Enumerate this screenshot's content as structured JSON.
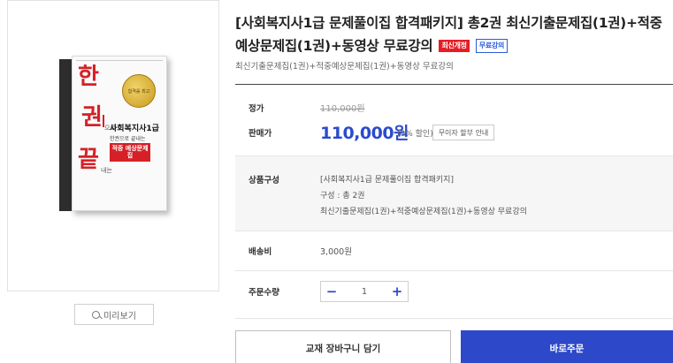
{
  "product": {
    "title_main": "[사회복지사1급 문제풀이집 합격패키지] 총2권 최신기출문제집(1권)+적중예상문제집(1권)+동영상 무료강의",
    "badges": [
      "최신개정",
      "무료강의"
    ],
    "subtitle": "최신기출문제집(1권)+적중예상문제집(1권)+동영상 무료강의"
  },
  "cover": {
    "big_chars": [
      "한",
      "권",
      "끝"
    ],
    "small_words": [
      "으로",
      "내는"
    ],
    "spine_text": "사회복지사1급",
    "badge_text": "합격률 최고",
    "subject": "사회복지사1급",
    "subject_sub": "한권으로 끝내는",
    "tag": "적중 예상문제집"
  },
  "preview": {
    "label": "미리보기",
    "icon": "search-icon"
  },
  "price": {
    "list_label": "정가",
    "list_value": "110,000원",
    "sale_label": "판매가",
    "sale_value": "110,000원",
    "discount": "(0% 할인)",
    "installment_label": "무이자 할부 안내"
  },
  "composition": {
    "label": "상품구성",
    "lines": [
      "[사회복지사1급 문제풀이집 합격패키지]",
      "구성 : 총 2권",
      "최신기출문제집(1권)+적중예상문제집(1권)+동영상 무료강의"
    ]
  },
  "shipping": {
    "label": "배송비",
    "value": "3,000원"
  },
  "quantity": {
    "label": "주문수량",
    "value": "1",
    "minus": "−",
    "plus": "+"
  },
  "actions": {
    "cart": "교재 장바구니 담기",
    "buy": "바로주문"
  },
  "colors": {
    "accent": "#2b4bcc",
    "buy_button": "#2d49c9",
    "badge_red": "#e41e26"
  }
}
